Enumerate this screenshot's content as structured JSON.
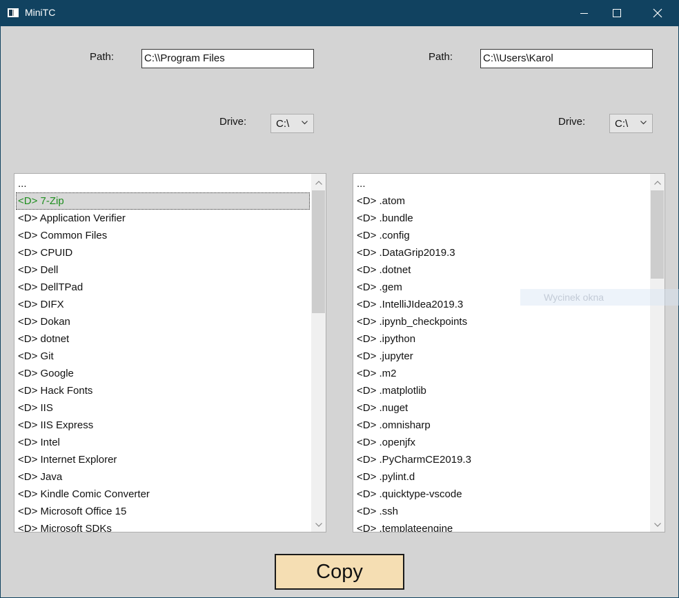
{
  "window": {
    "title": "MiniTC",
    "icon": "app-window-icon",
    "controls": [
      "minimize-icon",
      "maximize-icon",
      "close-icon"
    ]
  },
  "left": {
    "path_label": "Path:",
    "path_value": "C:\\\\Program Files",
    "drive_label": "Drive:",
    "drive_value": "C:\\",
    "items": [
      "...",
      "<D> 7-Zip",
      "<D> Application Verifier",
      "<D> Common Files",
      "<D> CPUID",
      "<D> Dell",
      "<D> DellTPad",
      "<D> DIFX",
      "<D> Dokan",
      "<D> dotnet",
      "<D> Git",
      "<D> Google",
      "<D> Hack Fonts",
      "<D> IIS",
      "<D> IIS Express",
      "<D> Intel",
      "<D> Internet Explorer",
      "<D> Java",
      "<D> Kindle Comic Converter",
      "<D> Microsoft Office 15",
      "<D> Microsoft SDKs"
    ],
    "selected_index": 1
  },
  "right": {
    "path_label": "Path:",
    "path_value": "C:\\\\Users\\Karol",
    "drive_label": "Drive:",
    "drive_value": "C:\\",
    "items": [
      "...",
      "<D> .atom",
      "<D> .bundle",
      "<D> .config",
      "<D> .DataGrip2019.3",
      "<D> .dotnet",
      "<D> .gem",
      "<D> .IntelliJIdea2019.3",
      "<D> .ipynb_checkpoints",
      "<D> .ipython",
      "<D> .jupyter",
      "<D> .m2",
      "<D> .matplotlib",
      "<D> .nuget",
      "<D> .omnisharp",
      "<D> .openjfx",
      "<D> .PyCharmCE2019.3",
      "<D> .pylint.d",
      "<D> .quicktype-vscode",
      "<D> .ssh",
      "<D> .templateengine"
    ]
  },
  "copy_button": {
    "label": "Copy",
    "color": "#f5deb3"
  },
  "tooltip": {
    "text": "Wycinek okna"
  },
  "colors": {
    "titlebar": "#114260",
    "background": "#d4d4d4",
    "selected_text": "#1e8e1e"
  }
}
